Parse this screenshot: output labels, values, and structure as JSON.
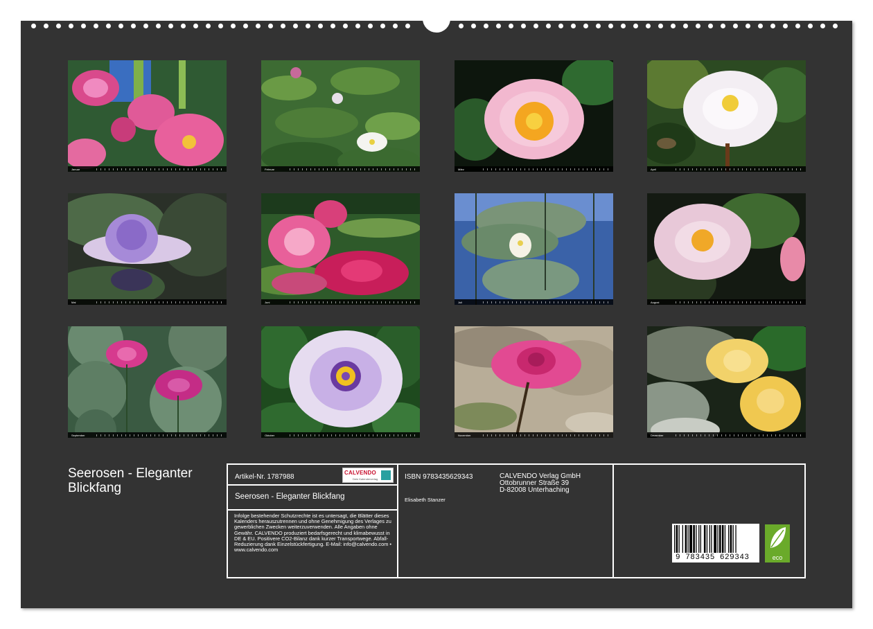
{
  "calendar": {
    "title": "Seerosen - Eleganter Blickfang",
    "months": [
      {
        "label": "Januar"
      },
      {
        "label": "Februar"
      },
      {
        "label": "März"
      },
      {
        "label": "April"
      },
      {
        "label": "Mai"
      },
      {
        "label": "Juni"
      },
      {
        "label": "Juli"
      },
      {
        "label": "August"
      },
      {
        "label": "September"
      },
      {
        "label": "Oktober"
      },
      {
        "label": "November"
      },
      {
        "label": "Dezember"
      }
    ]
  },
  "info": {
    "article": "Artikel-Nr. 1787988",
    "calendar_title": "Seerosen - Eleganter Blickfang",
    "legal": "Infolge bestehender Schutzrechte ist es untersagt, die Blätter dieses Kalenders herauszutrennen und ohne Genehmigung des Verlages zu gewerblichen Zwecken weiterzuverwenden. Alle Angaben ohne Gewähr. CALVENDO produziert bedarfsgerecht und klimabewusst in DE & EU. Positivere CO2-Bilanz dank kurzer Transportwege. Abfall-Reduzierung dank Einzelstückfertigung. E-Mail: info@calvendo.com • www.calvendo.com",
    "isbn": "ISBN 9783435629343",
    "author": "Elisabeth Stanzer",
    "publisher": {
      "name": "CALVENDO Verlag GmbH",
      "street": "Ottobrunner Straße 39",
      "city": "D-82008 Unterhaching"
    },
    "barcode_number": "9 783435 629343",
    "eco_label": "eco"
  },
  "logo": {
    "brand": "CALVENDO",
    "tagline": "Dein Kalenderverlag"
  }
}
